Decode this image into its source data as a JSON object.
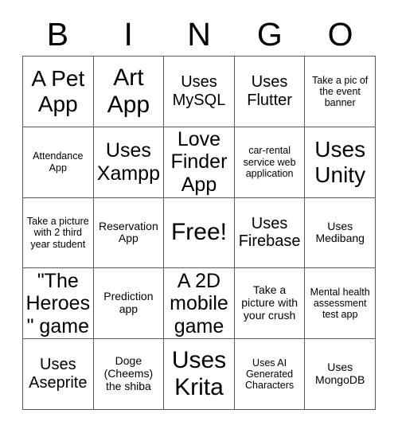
{
  "card": {
    "title_letters": [
      "B",
      "I",
      "N",
      "G",
      "O"
    ],
    "columns": 5,
    "rows": 5,
    "cells": [
      {
        "text": "A Pet App",
        "size": "fs-xl"
      },
      {
        "text": "Art App",
        "size": "fs-xxl"
      },
      {
        "text": "Uses MySQL",
        "size": "fs-md"
      },
      {
        "text": "Uses Flutter",
        "size": "fs-md"
      },
      {
        "text": "Take a pic of the event banner",
        "size": "fs-xs"
      },
      {
        "text": "Attendance App",
        "size": "fs-xs"
      },
      {
        "text": "Uses Xampp",
        "size": "fs-lg"
      },
      {
        "text": "Love Finder App",
        "size": "fs-lg"
      },
      {
        "text": "car-rental service web application",
        "size": "fs-xs"
      },
      {
        "text": "Uses Unity",
        "size": "fs-xl"
      },
      {
        "text": "Take a picture with 2 third year student",
        "size": "fs-xs"
      },
      {
        "text": "Reservation App",
        "size": "fs-sm"
      },
      {
        "text": "Free!",
        "size": "fs-xxl"
      },
      {
        "text": "Uses Firebase",
        "size": "fs-md"
      },
      {
        "text": "Uses Medibang",
        "size": "fs-sm"
      },
      {
        "text": "\"The Heroes\" game",
        "size": "fs-lg"
      },
      {
        "text": "Prediction app",
        "size": "fs-sm"
      },
      {
        "text": "A 2D mobile game",
        "size": "fs-lg"
      },
      {
        "text": "Take a picture with your crush",
        "size": "fs-sm"
      },
      {
        "text": "Mental health assessment test app",
        "size": "fs-xs"
      },
      {
        "text": "Uses Aseprite",
        "size": "fs-md"
      },
      {
        "text": "Doge (Cheems) the shiba",
        "size": "fs-sm"
      },
      {
        "text": "Uses Krita",
        "size": "fs-xxl"
      },
      {
        "text": "Uses AI Generated Characters",
        "size": "fs-xs"
      },
      {
        "text": "Uses MongoDB",
        "size": "fs-sm"
      }
    ]
  },
  "colors": {
    "background": "#ffffff",
    "text": "#000000",
    "grid_line": "#555a5e"
  }
}
